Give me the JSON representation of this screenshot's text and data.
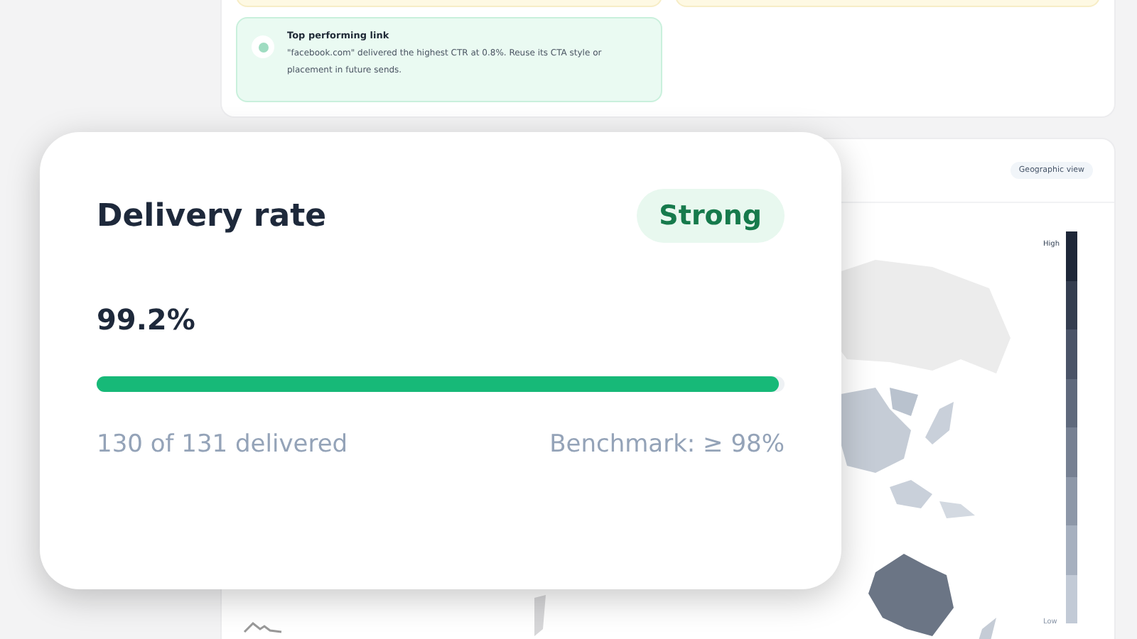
{
  "insight": {
    "title": "Top performing link",
    "text": "\"facebook.com\" delivered the highest CTR at 0.8%. Reuse its CTA style or placement in future sends."
  },
  "map": {
    "badge": "Geographic view",
    "legend_high": "High",
    "legend_low": "Low"
  },
  "delivery": {
    "title": "Delivery rate",
    "status": {
      "label": "Strong"
    },
    "value": "99.2%",
    "level": 0.992,
    "delivered": "130 of 131 delivered",
    "benchmark": "Benchmark: ≥ 98%"
  }
}
